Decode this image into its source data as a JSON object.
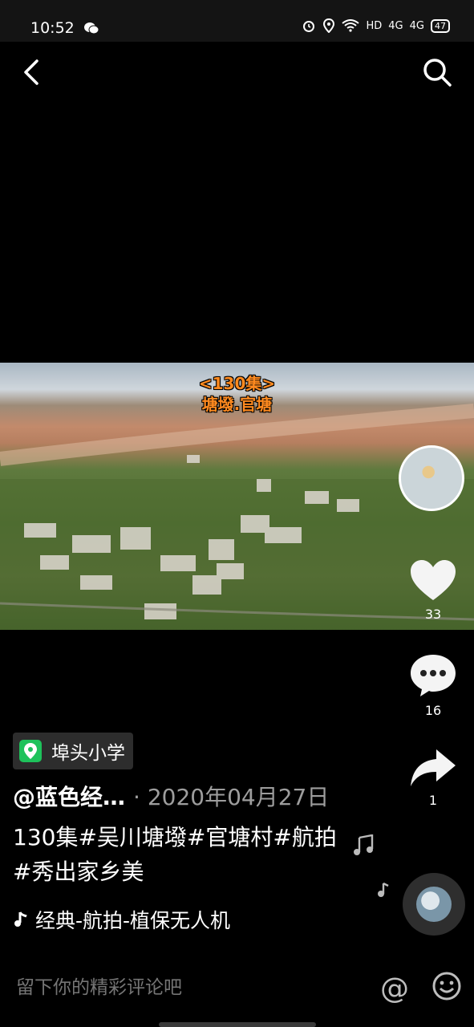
{
  "status": {
    "time": "10:52",
    "network": "HD",
    "sig1": "4G",
    "sig2": "4G",
    "battery": "47"
  },
  "video": {
    "overlay_line1": "<130集>",
    "overlay_line2": "塘墢.官塘"
  },
  "actions": {
    "like_count": "33",
    "comment_count": "16",
    "share_count": "1"
  },
  "location": {
    "label": "埠头小学"
  },
  "post": {
    "author": "@蓝色经…",
    "date": "· 2020年04月27日",
    "description": "130集#吴川塘墢#官塘村#航拍 #秀出家乡美",
    "music": "经典-航拍-植保无人机"
  },
  "comment_bar": {
    "placeholder": "留下你的精彩评论吧",
    "at_label": "@"
  },
  "colors": {
    "pin": "#1ec25b",
    "overlay_text": "#ff8a1f"
  },
  "icons": [
    "back-arrow-icon",
    "search-icon",
    "heart-icon",
    "comment-icon",
    "share-icon",
    "location-pin-icon",
    "music-note-icon",
    "emoji-icon",
    "wechat-icon",
    "alarm-icon",
    "location-status-icon",
    "wifi-icon"
  ]
}
